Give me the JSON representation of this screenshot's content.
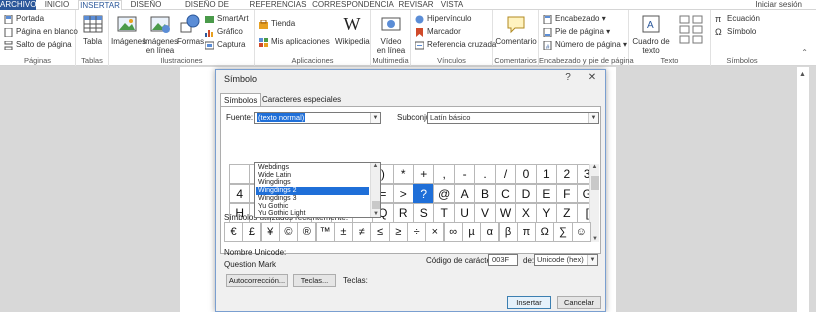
{
  "ribbon_tabs": [
    "ARCHIVO",
    "INICIO",
    "INSERTAR",
    "DISEÑO",
    "DISEÑO DE PÁGINA",
    "REFERENCIAS",
    "CORRESPONDENCIA",
    "REVISAR",
    "VISTA"
  ],
  "signin": "Iniciar sesión",
  "groups": {
    "paginas": {
      "label": "Páginas",
      "items": [
        "Portada",
        "Página en blanco",
        "Salto de página"
      ]
    },
    "tablas": {
      "label": "Tablas",
      "tabla": "Tabla"
    },
    "ilustraciones": {
      "label": "Ilustraciones",
      "imagenes": "Imágenes",
      "imagenes_linea_1": "Imágenes",
      "imagenes_linea_2": "en línea",
      "formas": "Formas",
      "smartart": "SmartArt",
      "grafico": "Gráfico",
      "captura": "Captura"
    },
    "aplicaciones": {
      "label": "Aplicaciones",
      "tienda": "Tienda",
      "mis_apps": "Mis aplicaciones",
      "wikipedia": "Wikipedia"
    },
    "multimedia": {
      "label": "Multimedia",
      "video_1": "Vídeo",
      "video_2": "en línea"
    },
    "vinculos": {
      "label": "Vínculos",
      "items": [
        "Hipervínculo",
        "Marcador",
        "Referencia cruzada"
      ]
    },
    "comentarios": {
      "label": "Comentarios",
      "comentario": "Comentario"
    },
    "encabezado": {
      "label": "Encabezado y pie de página",
      "items": [
        "Encabezado",
        "Pie de página",
        "Número de página"
      ]
    },
    "texto": {
      "label": "Texto",
      "cuadro_1": "Cuadro de",
      "cuadro_2": "texto"
    },
    "simbolos": {
      "label": "Símbolos",
      "ecuacion": "Ecuación",
      "simbolo": "Símbolo"
    }
  },
  "dialog": {
    "title": "Símbolo",
    "help": "?",
    "close": "✕",
    "tabs": [
      "Símbolos",
      "Caracteres especiales"
    ],
    "font_label": "Fuente:",
    "font_value": "(texto normal)",
    "subset_label": "Subconjunto:",
    "subset_value": "Latín básico",
    "font_options": [
      "Webdings",
      "Wide Latin",
      "Wingdings",
      "Wingdings 2",
      "Wingdings 3",
      "Yu Gothic",
      "Yu Gothic Light"
    ],
    "font_options_highlight": "Wingdings 2",
    "grid_rows": [
      [
        "",
        "",
        "",
        "",
        "",
        "",
        "(",
        ")",
        "*",
        "+",
        ",",
        "-",
        ".",
        "/",
        "0",
        "1",
        "2",
        "3"
      ],
      [
        "4",
        "",
        "",
        "",
        "",
        "",
        "<",
        "=",
        ">",
        "?",
        "@",
        "A",
        "B",
        "C",
        "D",
        "E",
        "F",
        "G"
      ],
      [
        "H",
        "",
        "",
        "",
        "",
        "",
        "P",
        "Q",
        "R",
        "S",
        "T",
        "U",
        "V",
        "W",
        "X",
        "Y",
        "Z",
        "["
      ],
      [
        "\\",
        "]",
        "^",
        "_",
        "`",
        "a",
        "b",
        "c",
        "d",
        "e",
        "f",
        "g",
        "h",
        "i",
        "j",
        "k",
        "l",
        "m",
        "n",
        "o"
      ]
    ],
    "selected_char": "?",
    "recent_label": "Símbolos utilizados recientemente:",
    "recent": [
      "€",
      "£",
      "¥",
      "©",
      "®",
      "™",
      "±",
      "≠",
      "≤",
      "≥",
      "÷",
      "×",
      "∞",
      "µ",
      "α",
      "β",
      "π",
      "Ω",
      "∑",
      "☺"
    ],
    "unicode_name_label": "Nombre Unicode:",
    "unicode_name": "Question Mark",
    "char_code_label": "Código de carácter:",
    "char_code": "003F",
    "from_label": "de:",
    "from_value": "Unicode (hex)",
    "autocorrect": "Autocorrección...",
    "shortcut_btn": "Teclas...",
    "shortcut_label": "Teclas:",
    "insert": "Insertar",
    "cancel": "Cancelar"
  }
}
